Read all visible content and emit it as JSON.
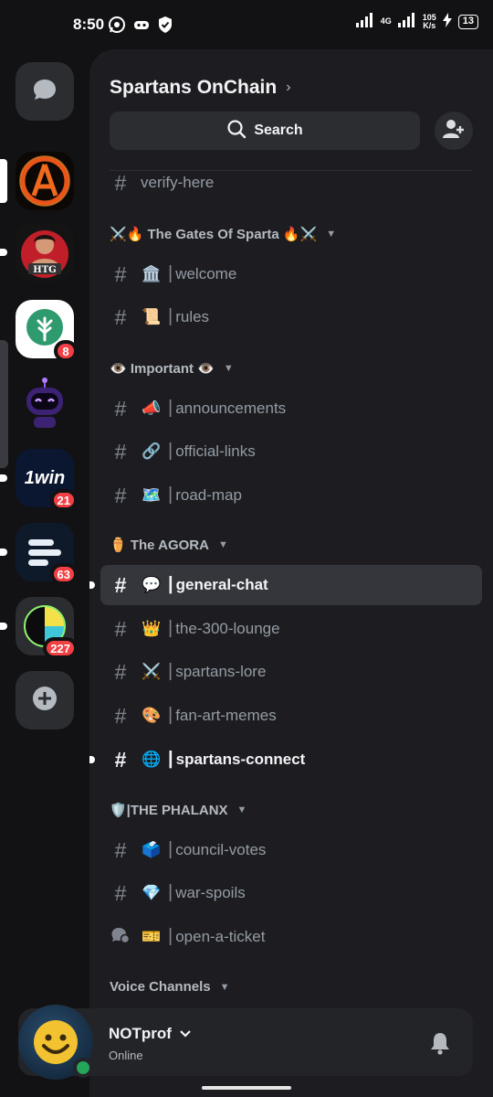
{
  "status_bar": {
    "time": "8:50",
    "network_type": "4G",
    "speed_value": "105",
    "speed_unit": "K/s",
    "battery": "13"
  },
  "server": {
    "name": "Spartans OnChain"
  },
  "search": {
    "label": "Search"
  },
  "servers": [
    {
      "name": "dm-home",
      "badge": ""
    },
    {
      "name": "spartans-onchain",
      "badge": ""
    },
    {
      "name": "htg",
      "badge": "",
      "logo_text": "HTG"
    },
    {
      "name": "green-tree",
      "badge": "8"
    },
    {
      "name": "robot",
      "badge": ""
    },
    {
      "name": "1win",
      "badge": "21",
      "logo_text": "1win"
    },
    {
      "name": "stack",
      "badge": "63"
    },
    {
      "name": "rainbow",
      "badge": "227"
    }
  ],
  "channels": [
    {
      "name": "verify-here",
      "emoji": "",
      "sep": ""
    },
    {
      "name": "welcome",
      "emoji": "🏛️",
      "sep": "|"
    },
    {
      "name": "rules",
      "emoji": "📜",
      "sep": "|"
    },
    {
      "name": "announcements",
      "emoji": "📣",
      "sep": "|"
    },
    {
      "name": "official-links",
      "emoji": "🔗",
      "sep": "|"
    },
    {
      "name": "road-map",
      "emoji": "🗺️",
      "sep": "|"
    },
    {
      "name": "general-chat",
      "emoji": "💬",
      "sep": "|"
    },
    {
      "name": "the-300-lounge",
      "emoji": "👑",
      "sep": "|"
    },
    {
      "name": "spartans-lore",
      "emoji": "⚔️",
      "sep": "|"
    },
    {
      "name": "fan-art-memes",
      "emoji": "🎨",
      "sep": "|"
    },
    {
      "name": "spartans-connect",
      "emoji": "🌐",
      "sep": "|"
    },
    {
      "name": "council-votes",
      "emoji": "🗳️",
      "sep": "|"
    },
    {
      "name": "war-spoils",
      "emoji": "💎",
      "sep": "|"
    },
    {
      "name": "open-a-ticket",
      "emoji": "🎫",
      "sep": "|"
    }
  ],
  "categories": [
    {
      "label": "⚔️🔥 The Gates Of Sparta 🔥⚔️"
    },
    {
      "label": "👁️ Important 👁️"
    },
    {
      "label": "⚱️ The AGORA"
    },
    {
      "label": "🛡️|THE PHALANX"
    },
    {
      "label": "Voice Channels"
    }
  ],
  "user": {
    "name": "NOTprof",
    "status": "Online"
  },
  "colors": {
    "background": "#121214",
    "panel": "#1d1d21",
    "online": "#23a55a",
    "badge": "#f23f43"
  }
}
